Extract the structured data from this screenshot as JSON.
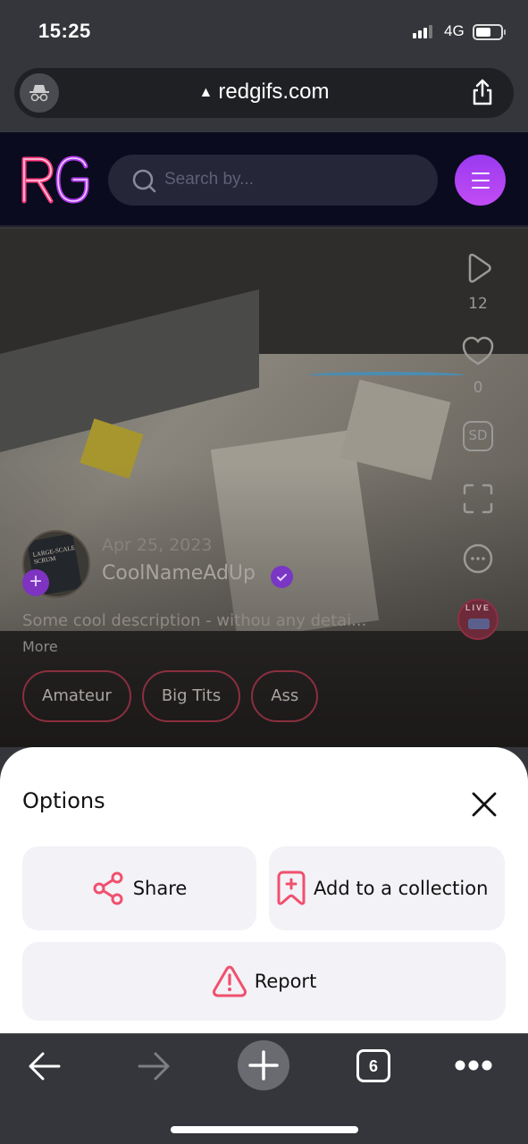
{
  "status_bar": {
    "time": "15:25",
    "network": "4G",
    "battery_level": 0.5,
    "signal_bars": 3
  },
  "browser": {
    "url": "redgifs.com",
    "tabs_count": "6",
    "security_warning_icon": "warning-triangle-icon"
  },
  "site_header": {
    "logo": "RG",
    "search_placeholder": "Search by..."
  },
  "post": {
    "date": "Apr 25, 2023",
    "username": "CoolNameAdUp",
    "verified": true,
    "description": "Some cool description - withou any detai...",
    "more_label": "More",
    "views": "12",
    "likes": "0",
    "quality_label": "SD",
    "live_label": "LIVE",
    "avatar_text": "LARGE-SCALE SCRUM",
    "tags": [
      "Amateur",
      "Big Tits",
      "Ass"
    ]
  },
  "options_sheet": {
    "title": "Options",
    "buttons": {
      "share": "Share",
      "add_collection": "Add to a collection",
      "report": "Report"
    },
    "accent_color": "#f0506e"
  }
}
